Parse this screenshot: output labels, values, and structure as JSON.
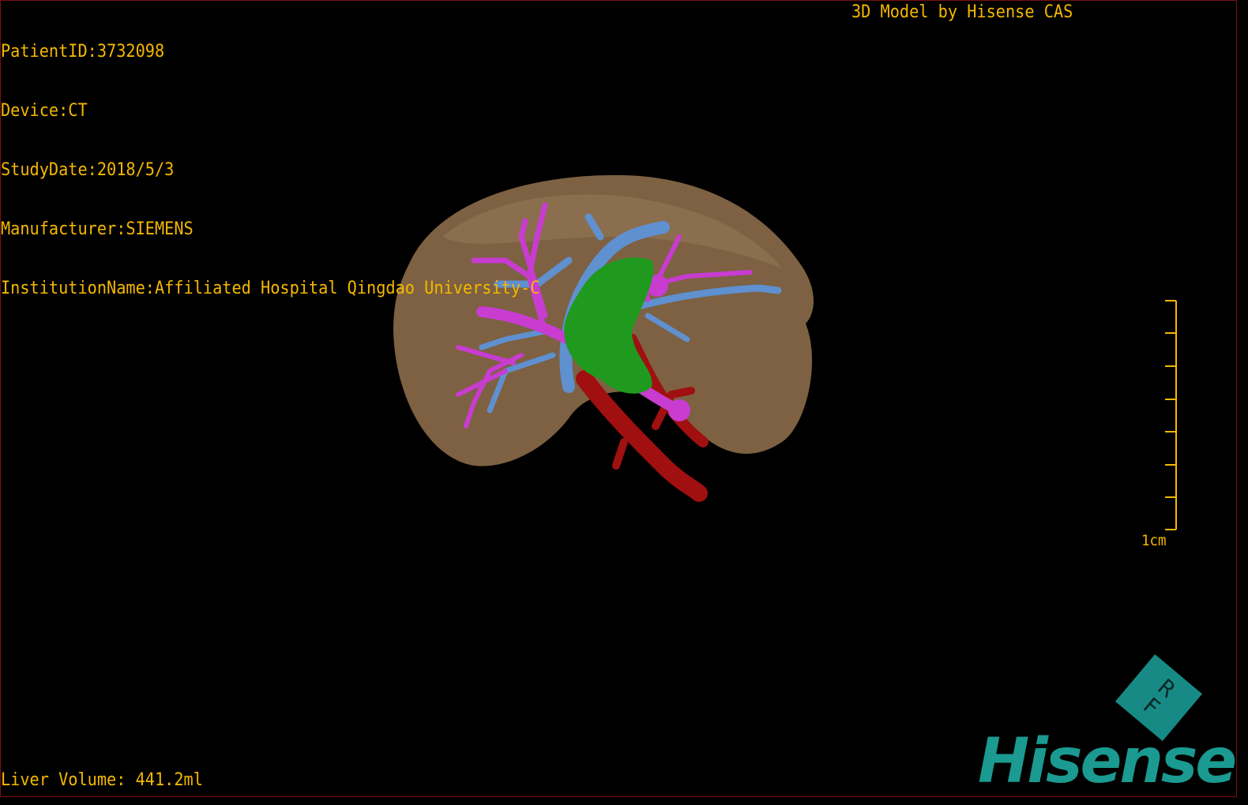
{
  "header": {
    "patient_id": "PatientID:3732098",
    "device": "Device:CT",
    "study_date": "StudyDate:2018/5/3",
    "manufacturer": "Manufacturer:SIEMENS",
    "institution": "InstitutionName:Affiliated Hospital Qingdao University-C",
    "model_credit": "3D Model by Hisense CAS"
  },
  "footer": {
    "liver_volume": "Liver Volume: 441.2ml"
  },
  "scale_bar": {
    "label": "1cm",
    "ticks": 8
  },
  "logo": {
    "brand": "Hisense",
    "badge_top": "R",
    "badge_bottom": "F"
  },
  "colors": {
    "overlay_text": "#f5b800",
    "liver": "#8a6d48",
    "portal_vein": "#c83cd0",
    "hepatic_vein": "#5f90d0",
    "artery": "#a01010",
    "gallbladder": "#1f9a1f",
    "brand": "#1a9a90"
  }
}
